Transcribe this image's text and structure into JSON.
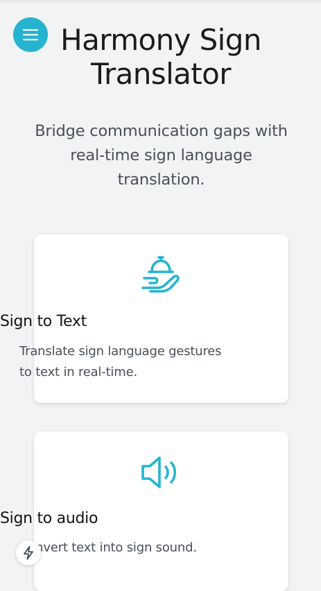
{
  "header": {
    "title": "Harmony Sign Translator",
    "subtitle": "Bridge communication gaps with real-time sign language translation."
  },
  "menu_button": {
    "icon": "hamburger-menu-icon"
  },
  "cards": [
    {
      "icon": "serving-hand-icon",
      "title": "Sign to Text",
      "description": "Translate sign language gestures to text in real-time."
    },
    {
      "icon": "speaker-volume-icon",
      "title": "Sign to audio",
      "description": "Convert text into sign sound."
    }
  ],
  "floating_button": {
    "icon": "lightning-bolt-icon"
  },
  "colors": {
    "accent": "#25b3cf",
    "background": "#f2f3f5",
    "card": "#ffffff",
    "title_text": "#1b1b1b",
    "body_text": "#4a4f57"
  }
}
